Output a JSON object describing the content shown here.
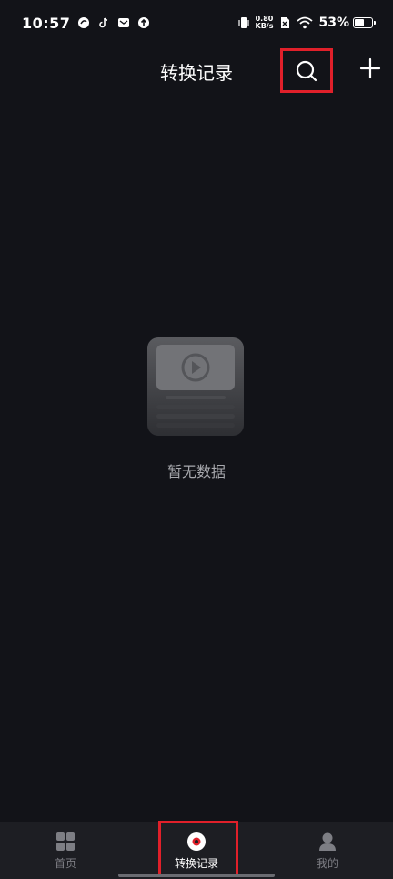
{
  "status_bar": {
    "time": "10:57",
    "net_speed_value": "0.80",
    "net_speed_unit": "KB/s",
    "battery_percent": "53%",
    "battery_level": 0.53
  },
  "header": {
    "title": "转换记录",
    "search_icon": "search-icon",
    "add_icon": "plus-icon"
  },
  "empty_state": {
    "message": "暂无数据"
  },
  "bottom_nav": {
    "items": [
      {
        "label": "首页",
        "icon": "grid-icon",
        "active": false
      },
      {
        "label": "转换记录",
        "icon": "record-icon",
        "active": true
      },
      {
        "label": "我的",
        "icon": "person-icon",
        "active": false
      }
    ]
  },
  "colors": {
    "background": "#121318",
    "nav_background": "#1d1e23",
    "highlight": "#e0202a",
    "muted_text": "#a8a9ae"
  }
}
